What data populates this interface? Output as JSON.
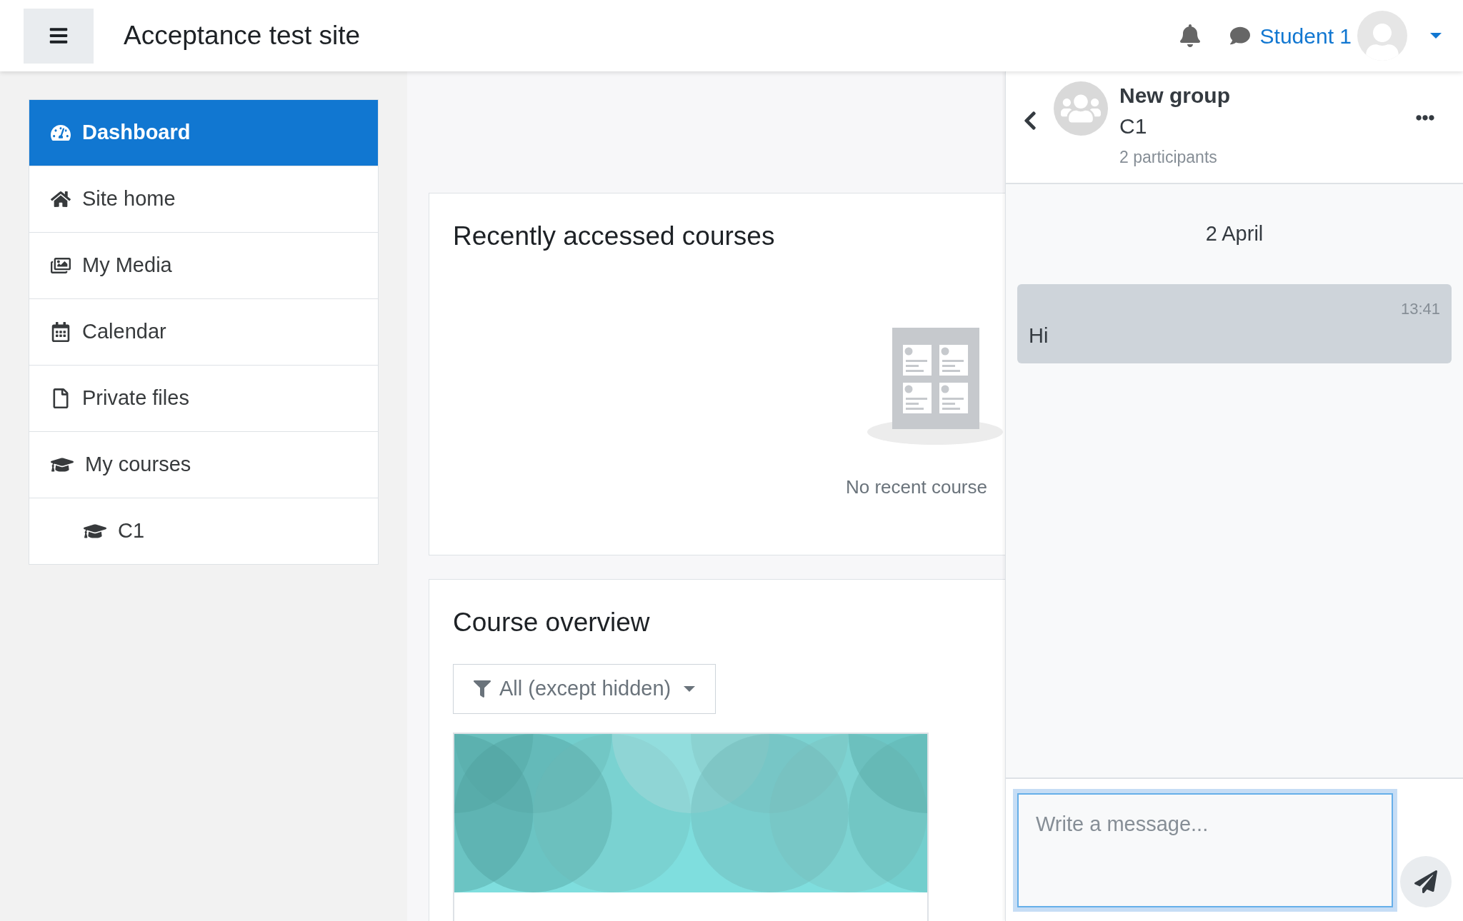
{
  "header": {
    "site_name": "Acceptance test site",
    "user_name": "Student 1"
  },
  "nav": [
    {
      "label": "Dashboard",
      "kind": "dashboard",
      "selected": true
    },
    {
      "label": "Site home",
      "kind": "home",
      "selected": false
    },
    {
      "label": "My Media",
      "kind": "media",
      "selected": false
    },
    {
      "label": "Calendar",
      "kind": "calendar",
      "selected": false
    },
    {
      "label": "Private files",
      "kind": "file",
      "selected": false
    },
    {
      "label": "My courses",
      "kind": "course",
      "selected": false,
      "children": [
        {
          "label": "C1",
          "kind": "course",
          "selected": false
        }
      ]
    }
  ],
  "main": {
    "recent_card": {
      "title": "Recently accessed courses",
      "empty_text": "No recent course"
    },
    "overview_card": {
      "title": "Course overview",
      "filter": "All (except hidden)"
    }
  },
  "drawer": {
    "title": "New group",
    "subtitle": "C1",
    "participants": "2 participants",
    "date": "2 April",
    "messages": [
      {
        "time": "13:41",
        "text": "Hi"
      }
    ],
    "composer": {
      "placeholder": "Write a message..."
    }
  }
}
